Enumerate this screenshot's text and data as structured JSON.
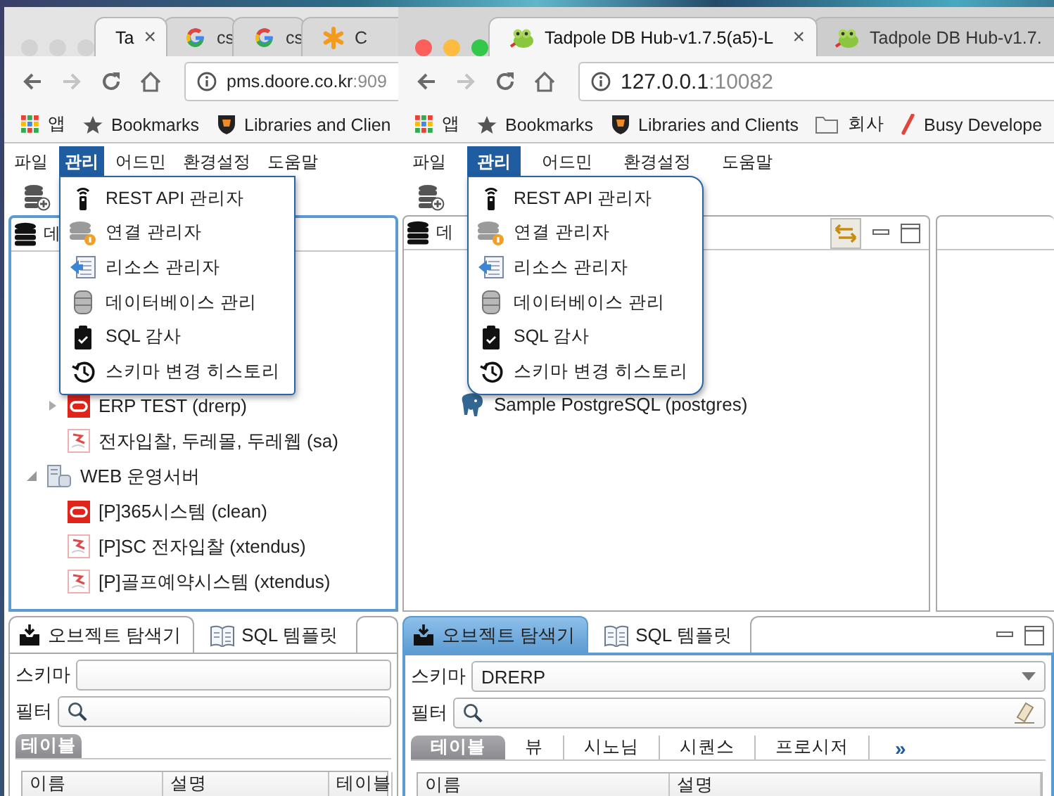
{
  "windows": [
    {
      "active": false,
      "tabs": [
        {
          "kind": "plain",
          "title": "Ta",
          "selected": true,
          "close": "×"
        },
        {
          "kind": "google",
          "title": "cs",
          "selected": false
        },
        {
          "kind": "google",
          "title": "cs",
          "selected": false
        },
        {
          "kind": "asterisk",
          "title": "C",
          "selected": false
        }
      ],
      "address": {
        "host": "pms.doore.co.kr",
        "port": ":909"
      },
      "bookmarks": [
        {
          "kind": "apps",
          "label": "앱"
        },
        {
          "kind": "star",
          "label": "Bookmarks"
        },
        {
          "kind": "crest",
          "label": "Libraries and Clien"
        }
      ],
      "menubar": [
        {
          "label": "파일",
          "selected": false
        },
        {
          "label": "관리",
          "selected": true
        },
        {
          "label": "어드민",
          "selected": false
        },
        {
          "label": "환경설정",
          "selected": false
        },
        {
          "label": "도움말",
          "selected": false
        }
      ],
      "menu": [
        {
          "kind": "antenna",
          "label": "REST API 관리자"
        },
        {
          "kind": "connection",
          "label": "연결 관리자"
        },
        {
          "kind": "resource",
          "label": "리소스 관리자"
        },
        {
          "kind": "database",
          "label": "데이터베이스 관리"
        },
        {
          "kind": "clipboard",
          "label": "SQL 감사"
        },
        {
          "kind": "history",
          "label": "스키마 변경 히스토리"
        }
      ],
      "panels": [
        {
          "title": "데",
          "focused": true,
          "tree": [
            {
              "children": [
                {
                  "kind": "oracle",
                  "label": "ERP TEST (drerp)",
                  "expanded": false
                },
                {
                  "kind": "mssql",
                  "label": "전자입찰, 두레몰, 두레웹 (sa)"
                }
              ]
            },
            {
              "kind": "server",
              "label": "WEB 운영서버",
              "expanded": true,
              "children": [
                {
                  "kind": "oracle",
                  "label": "[P]365시스템 (clean)"
                },
                {
                  "kind": "mssql",
                  "label": "[P]SC 전자입찰 (xtendus)"
                },
                {
                  "kind": "mssql",
                  "label": "[P]골프예약시스템 (xtendus)"
                }
              ]
            }
          ]
        }
      ],
      "explorer": {
        "focused": false,
        "tabs": [
          {
            "kind": "inbox",
            "label": "오브젝트 탐색기",
            "selected": true
          },
          {
            "kind": "book",
            "label": "SQL 템플릿",
            "selected": false
          }
        ],
        "schema": {
          "label": "스키마",
          "dropdown": false
        },
        "filter": {
          "label": "필터",
          "clear_button": false
        },
        "subtabs": [
          {
            "label": "테이블",
            "selected": true
          }
        ],
        "columns": [
          "이름",
          "설명",
          "테이블"
        ]
      }
    },
    {
      "active": true,
      "tabs": [
        {
          "kind": "tadpole",
          "title": "Tadpole DB Hub-v1.7.5(a5)-L",
          "selected": true,
          "close": "×"
        },
        {
          "kind": "tadpole",
          "title": "Tadpole DB Hub-v1.7.",
          "selected": false
        }
      ],
      "address": {
        "host": "127.0.0.1",
        "port": ":10082"
      },
      "bookmarks": [
        {
          "kind": "apps",
          "label": "앱"
        },
        {
          "kind": "star",
          "label": "Bookmarks"
        },
        {
          "kind": "crest",
          "label": "Libraries and Clients"
        },
        {
          "kind": "folder",
          "label": "회사"
        },
        {
          "kind": "pen",
          "label": "Busy Develope"
        }
      ],
      "menubar": [
        {
          "label": "파일",
          "selected": false
        },
        {
          "label": "관리",
          "selected": true
        },
        {
          "label": "어드민",
          "selected": false
        },
        {
          "label": "환경설정",
          "selected": false
        },
        {
          "label": "도움말",
          "selected": false
        }
      ],
      "menu": [
        {
          "kind": "antenna",
          "label": "REST API 관리자"
        },
        {
          "kind": "connection",
          "label": "연결 관리자"
        },
        {
          "kind": "resource",
          "label": "리소스 관리자"
        },
        {
          "kind": "database",
          "label": "데이터베이스 관리"
        },
        {
          "kind": "clipboard",
          "label": "SQL 감사"
        },
        {
          "kind": "history",
          "label": "스키마 변경 히스토리"
        }
      ],
      "panels": [
        {
          "title": "데",
          "focused": false,
          "buttons": [
            {
              "kind": "sync"
            },
            {
              "kind": "minimize"
            },
            {
              "kind": "maximize"
            }
          ],
          "tree": [
            {
              "children": [
                {
                  "kind": "postgres",
                  "label": "Sample PostgreSQL (postgres)"
                }
              ]
            }
          ]
        },
        {
          "focused": false
        }
      ],
      "explorer": {
        "focused": true,
        "tabs": [
          {
            "kind": "inbox",
            "label": "오브젝트 탐색기",
            "selected": true
          },
          {
            "kind": "book",
            "label": "SQL 템플릿",
            "selected": false
          }
        ],
        "buttons": [
          {
            "kind": "minimize"
          },
          {
            "kind": "maximize"
          }
        ],
        "schema": {
          "label": "스키마",
          "value": "DRERP",
          "dropdown": true
        },
        "filter": {
          "label": "필터",
          "clear_button": true
        },
        "subtabs": [
          {
            "label": "테이블",
            "selected": true
          },
          {
            "label": "뷰",
            "selected": false
          },
          {
            "label": "시노님",
            "selected": false
          },
          {
            "label": "시퀀스",
            "selected": false
          },
          {
            "label": "프로시저",
            "selected": false
          }
        ],
        "more": "»",
        "columns": [
          "이름",
          "설명"
        ]
      }
    }
  ]
}
